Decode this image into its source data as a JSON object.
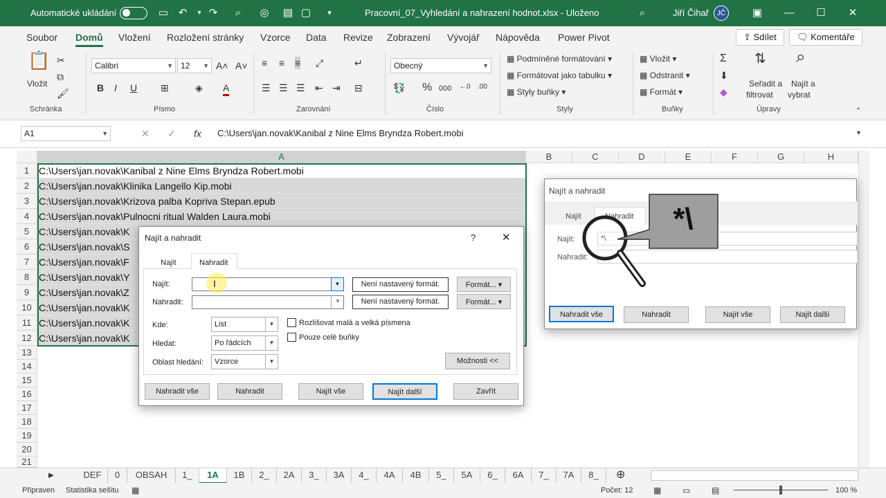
{
  "titlebar": {
    "autosave_label": "Automatické ukládání",
    "document_title": "Pracovní_07_Vyhledání a nahrazení hodnot.xlsx  -  Uloženo",
    "user_name": "Jiří Čihař",
    "user_initials": "JČ"
  },
  "ribbon": {
    "tabs": [
      "Soubor",
      "Domů",
      "Vložení",
      "Rozložení stránky",
      "Vzorce",
      "Data",
      "Revize",
      "Zobrazení",
      "Vývojář",
      "Nápověda",
      "Power Pivot"
    ],
    "share_label": "Sdílet",
    "comments_label": "Komentáře",
    "groups": {
      "clipboard": "Schránka",
      "font": "Písmo",
      "alignment": "Zarovnání",
      "number": "Číslo",
      "styles": "Styly",
      "cells": "Buňky",
      "editing": "Úpravy"
    },
    "paste_label": "Vložit",
    "font_name": "Calibri",
    "font_size": "12",
    "number_format": "Obecný",
    "styles_items": [
      "Podmíněné formátování",
      "Formátovat jako tabulku",
      "Styly buňky"
    ],
    "cells_items": [
      "Vložit",
      "Odstranit",
      "Formát"
    ],
    "sort_label_1": "Seřadit a",
    "sort_label_2": "filtrovat",
    "find_label_1": "Najít a",
    "find_label_2": "vybrat"
  },
  "formula_bar": {
    "name_box": "A1",
    "formula": "C:\\Users\\jan.novak\\Kanibal z Nine Elms  Bryndza Robert.mobi"
  },
  "grid": {
    "columns": [
      "A",
      "B",
      "C",
      "D",
      "E",
      "F",
      "G",
      "H"
    ],
    "row_numbers": [
      "1",
      "2",
      "3",
      "4",
      "5",
      "6",
      "7",
      "8",
      "9",
      "10",
      "11",
      "12",
      "13",
      "14",
      "15",
      "16",
      "17",
      "18",
      "19",
      "20",
      "21"
    ],
    "cells": [
      "C:\\Users\\jan.novak\\Kanibal z Nine Elms   Bryndza Robert.mobi",
      "C:\\Users\\jan.novak\\Klinika   Langello  Kip.mobi",
      "C:\\Users\\jan.novak\\Krizova palba   Kopriva Stepan.epub",
      "C:\\Users\\jan.novak\\Pulnocni ritual   Walden  Laura.mobi",
      "C:\\Users\\jan.novak\\K",
      "C:\\Users\\jan.novak\\S",
      "C:\\Users\\jan.novak\\F",
      "C:\\Users\\jan.novak\\Y",
      "C:\\Users\\jan.novak\\Z",
      "C:\\Users\\jan.novak\\K",
      "C:\\Users\\jan.novak\\K",
      "C:\\Users\\jan.novak\\K"
    ]
  },
  "sheet_tabs": [
    "DEF",
    "0",
    "OBSAH",
    "1_",
    "1A",
    "1B",
    "2_",
    "2A",
    "3_",
    "3A",
    "4_",
    "4A",
    "4B",
    "5_",
    "5A",
    "6_",
    "6A",
    "7_",
    "7A",
    "8_"
  ],
  "status": {
    "ready": "Připraven",
    "accessibility": "Statistika sešitu",
    "count": "Počet: 12",
    "zoom": "100 %"
  },
  "dialog": {
    "title": "Najít a nahradit",
    "help": "?",
    "tab_find": "Najít",
    "tab_replace": "Nahradit",
    "find_label": "Najít:",
    "replace_label": "Nahradit:",
    "find_value": "",
    "replace_value": "",
    "no_format": "Není nastavený formát.",
    "format_btn": "Formát...",
    "within_label": "Kde:",
    "within_value": "List",
    "search_label": "Hledat:",
    "search_value": "Po řádcích",
    "lookin_label": "Oblast hledání:",
    "lookin_value": "Vzorce",
    "match_case": "Rozlišovat malá a velká písmena",
    "whole_cells": "Pouze celé buňky",
    "options_btn": "Možnosti <<",
    "replace_all": "Nahradit vše",
    "replace": "Nahradit",
    "find_all": "Najít vše",
    "find_next": "Najít další",
    "close": "Zavřít"
  },
  "zoom_inset": {
    "title": "Najít a nahradit",
    "tab_find": "Najít",
    "tab_replace": "Nahradit",
    "find_label": "Najít:",
    "find_value": "*\\",
    "replace_label": "Nahradit:",
    "callout": "*\\",
    "replace_all": "Nahradit vše",
    "replace": "Nahradit",
    "find_all": "Najít vše",
    "find_next": "Najít další"
  }
}
